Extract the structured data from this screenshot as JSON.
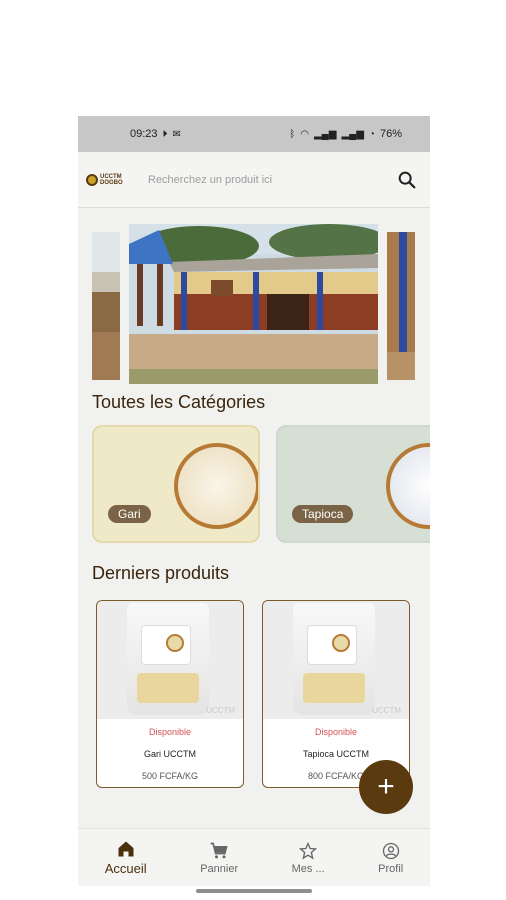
{
  "status_bar": {
    "time": "09:23",
    "battery": "76%"
  },
  "header": {
    "logo_text_1": "UCCTM",
    "logo_text_2": "DOGBO",
    "search_placeholder": "Recherchez un produit ici"
  },
  "categories": {
    "title": "Toutes les Catégories",
    "items": [
      {
        "label": "Gari"
      },
      {
        "label": "Tapioca"
      }
    ]
  },
  "latest": {
    "title": "Derniers produits",
    "products": [
      {
        "status": "Disponible",
        "name": "Gari UCCTM",
        "price": "500 FCFA/KG",
        "watermark": "UCCTM"
      },
      {
        "status": "Disponible",
        "name": "Tapioca UCCTM",
        "price": "800 FCFA/KG",
        "watermark": "UCCTM"
      }
    ]
  },
  "fab": {
    "label": "+"
  },
  "nav": {
    "items": [
      {
        "label": "Accueil",
        "icon": "home-icon",
        "active": true
      },
      {
        "label": "Pannier",
        "icon": "cart-icon"
      },
      {
        "label": "Mes ...",
        "icon": "star-icon"
      },
      {
        "label": "Profil",
        "icon": "profile-icon"
      }
    ]
  },
  "colors": {
    "brand": "#5b3a0f",
    "available": "#d65252"
  }
}
